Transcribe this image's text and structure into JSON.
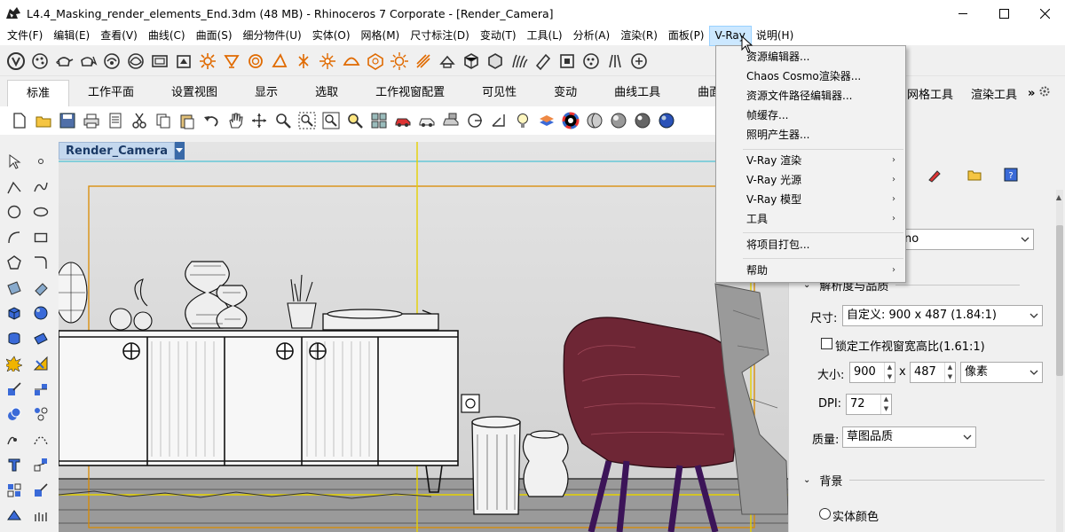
{
  "window": {
    "title": "L4.4_Masking_render_elements_End.3dm (48 MB) - Rhinoceros 7 Corporate - [Render_Camera]",
    "controls": [
      "minimize",
      "maximize",
      "close"
    ]
  },
  "menubar": {
    "items": [
      "文件(F)",
      "编辑(E)",
      "查看(V)",
      "曲线(C)",
      "曲面(S)",
      "细分物件(U)",
      "实体(O)",
      "网格(M)",
      "尺寸标注(D)",
      "变动(T)",
      "工具(L)",
      "分析(A)",
      "渲染(R)",
      "面板(P)",
      "V-Ray",
      "说明(H)"
    ],
    "active": "V-Ray"
  },
  "tabs": {
    "items": [
      "标准",
      "工作平面",
      "设置视图",
      "显示",
      "选取",
      "工作视窗配置",
      "可见性",
      "变动",
      "曲线工具",
      "曲面工具",
      "网格工具",
      "渲染工具"
    ],
    "active": "标准",
    "overflow": "»"
  },
  "viewport": {
    "name": "Render_Camera",
    "accent_border": "#e5c100",
    "safe_frame": "#d98a00"
  },
  "vray_menu": {
    "items": [
      {
        "label": "资源编辑器...",
        "submenu": false
      },
      {
        "label": "Chaos Cosmo渲染器...",
        "submenu": false
      },
      {
        "label": "资源文件路径编辑器...",
        "submenu": false
      },
      {
        "label": "帧缓存...",
        "submenu": false
      },
      {
        "label": "照明产生器...",
        "submenu": false
      },
      {
        "label": "V-Ray 渲染",
        "submenu": true
      },
      {
        "label": "V-Ray 光源",
        "submenu": true
      },
      {
        "label": "V-Ray 模型",
        "submenu": true
      },
      {
        "label": "工具",
        "submenu": true
      },
      {
        "label": "将项目打包...",
        "submenu": false
      },
      {
        "label": "帮助",
        "submenu": true
      }
    ]
  },
  "settings_panel": {
    "preset_suffix": "no",
    "section_resolution": "解析度与品质",
    "size_label": "尺寸:",
    "size_value": "自定义: 900 x 487 (1.84:1)",
    "lock_label": "锁定工作视窗宽高比(1.61:1)",
    "dims_label": "大小:",
    "width": "900",
    "x_sep": "x",
    "height": "487",
    "unit": "像素",
    "dpi_label": "DPI:",
    "dpi": "72",
    "quality_label": "质量:",
    "quality": "草图品质",
    "section_background": "背景",
    "bg_option": "实体颜色"
  }
}
